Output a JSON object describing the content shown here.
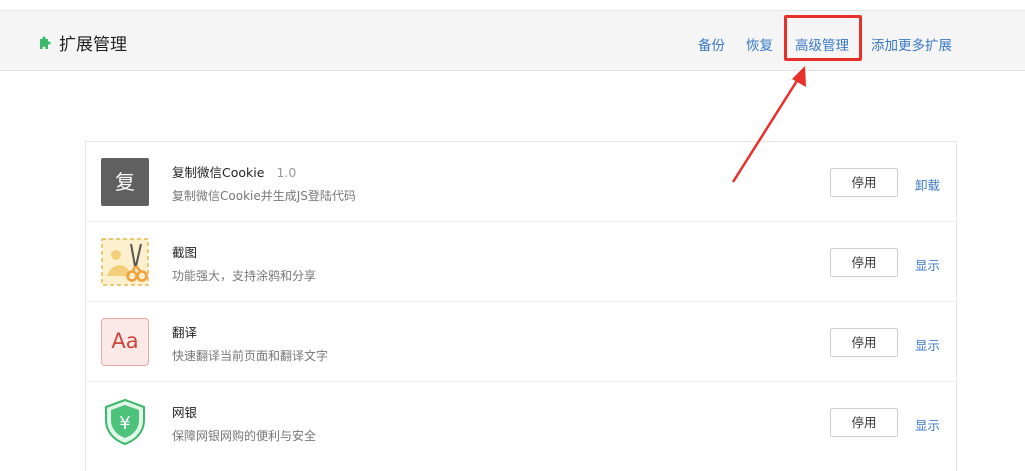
{
  "header": {
    "title": "扩展管理",
    "icon": "puzzle-icon",
    "links": {
      "backup": "备份",
      "restore": "恢复",
      "advanced": "高级管理",
      "add_more": "添加更多扩展"
    }
  },
  "annotation": {
    "highlight_color": "#e8302a"
  },
  "extensions": [
    {
      "icon_char": "复",
      "name": "复制微信Cookie",
      "version": "1.0",
      "desc": "复制微信Cookie并生成JS登陆代码",
      "button": "停用",
      "action": "卸载"
    },
    {
      "icon": "screenshot-scissors-icon",
      "name": "截图",
      "desc": "功能强大，支持涂鸦和分享",
      "button": "停用",
      "action": "显示"
    },
    {
      "icon_char": "Aa",
      "name": "翻译",
      "desc": "快速翻译当前页面和翻译文字",
      "button": "停用",
      "action": "显示"
    },
    {
      "icon_char": "¥",
      "name": "网银",
      "desc": "保障网银网购的便利与安全",
      "button": "停用",
      "action": "显示"
    }
  ],
  "colors": {
    "link": "#3a79c6",
    "accent_green": "#3bb86a"
  }
}
